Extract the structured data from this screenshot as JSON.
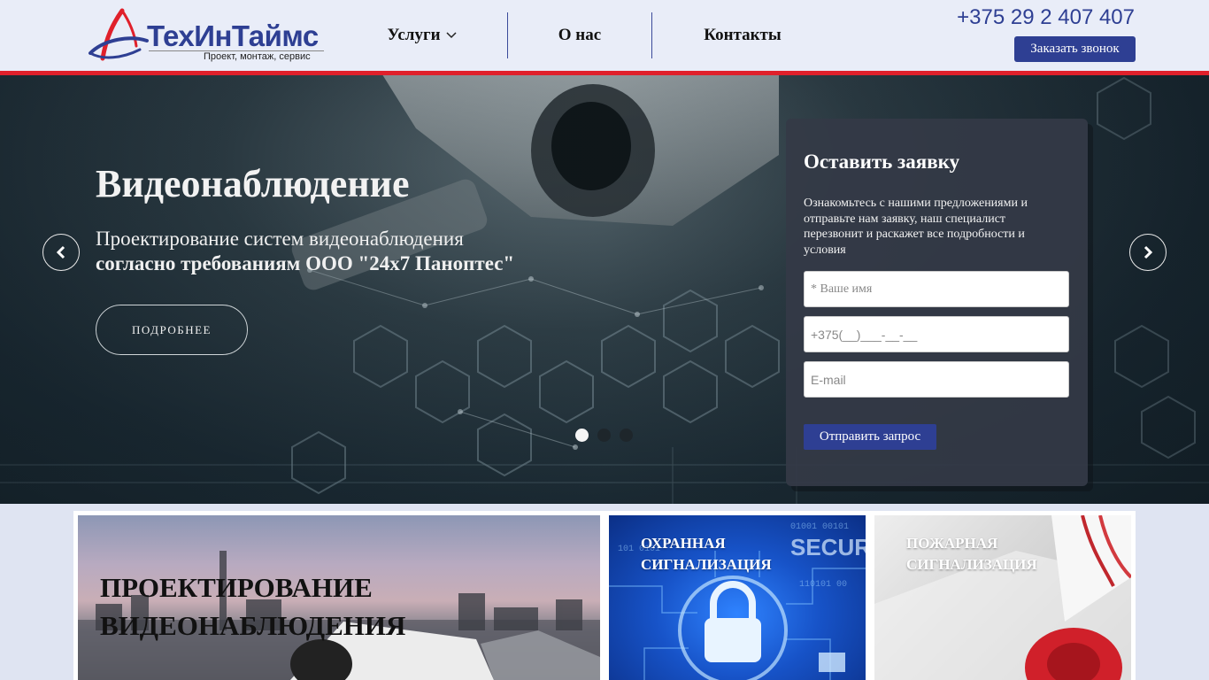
{
  "header": {
    "logo": {
      "name": "ТехИнТаймс",
      "tagline": "Проект, монтаж, сервис"
    },
    "nav": [
      {
        "label": "Услуги",
        "icon": "chevron-down-icon"
      },
      {
        "label": "О нас"
      },
      {
        "label": "Контакты"
      }
    ],
    "phone": "+375 29 2 407 407",
    "callback_label": "Заказать звонок"
  },
  "hero": {
    "title": "Видеонаблюдение",
    "subtitle_line1": "Проектирование систем видеонаблюдения",
    "subtitle_line2": "согласно требованиям ООО \"24х7 Паноптес\"",
    "more_label": "ПОДРОБНЕЕ",
    "slides_count": 3,
    "active_slide": 1
  },
  "form": {
    "title": "Оставить заявку",
    "description": "Ознакомьтесь с нашими предложениями и отправьте нам заявку, наш специалист перезвонит и раскажет все подробности и условия",
    "name_placeholder": "* Ваше имя",
    "phone_placeholder": "+375(__)___-__-__",
    "email_placeholder": "E-mail",
    "submit_label": "Отправить запрос"
  },
  "tiles": [
    {
      "line1": "ПРОЕКТИРОВАНИЕ",
      "line2": "ВИДЕОНАБЛЮДЕНИЯ"
    },
    {
      "line1": "ОХРАННАЯ",
      "line2": "СИГНАЛИЗАЦИЯ"
    },
    {
      "line1": "ПОЖАРНАЯ",
      "line2": "СИГНАЛИЗАЦИЯ"
    }
  ],
  "colors": {
    "brand": "#2e3f93",
    "accent": "#e0202b"
  }
}
